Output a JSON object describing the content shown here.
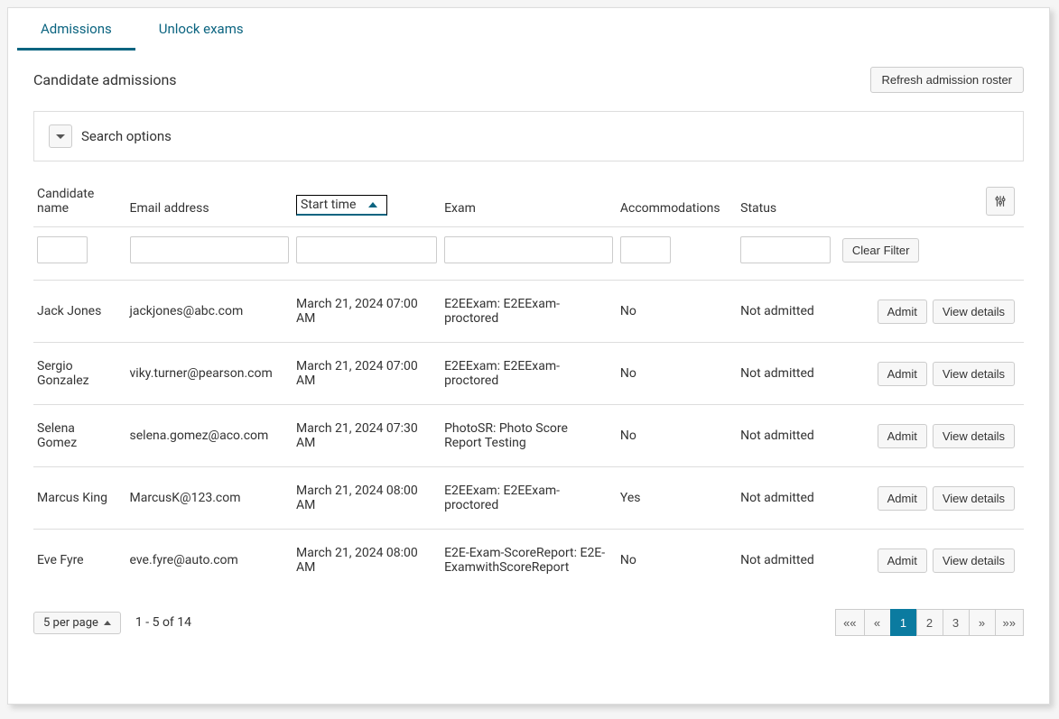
{
  "tabs": {
    "admissions": "Admissions",
    "unlock_exams": "Unlock exams"
  },
  "section": {
    "title": "Candidate admissions",
    "refresh_label": "Refresh admission roster",
    "search_options_label": "Search options"
  },
  "columns": {
    "candidate_name": "Candidate name",
    "email": "Email address",
    "start_time": "Start time",
    "exam": "Exam",
    "accommodations": "Accommodations",
    "status": "Status"
  },
  "filter": {
    "clear_label": "Clear Filter"
  },
  "row_actions": {
    "admit": "Admit",
    "view": "View details"
  },
  "rows": [
    {
      "name": "Jack Jones",
      "email": "jackjones@abc.com",
      "start": "March 21, 2024 07:00 AM",
      "exam": "E2EExam: E2EExam-proctored",
      "accom": "No",
      "status": "Not admitted"
    },
    {
      "name": "Sergio Gonzalez",
      "email": "viky.turner@pearson.com",
      "start": "March 21, 2024 07:00 AM",
      "exam": "E2EExam: E2EExam-proctored",
      "accom": "No",
      "status": "Not admitted"
    },
    {
      "name": "Selena Gomez",
      "email": "selena.gomez@aco.com",
      "start": "March 21, 2024 07:30 AM",
      "exam": "PhotoSR: Photo Score Report Testing",
      "accom": "No",
      "status": "Not admitted"
    },
    {
      "name": "Marcus King",
      "email": "MarcusK@123.com",
      "start": "March 21, 2024 08:00 AM",
      "exam": "E2EExam: E2EExam-proctored",
      "accom": "Yes",
      "status": "Not admitted"
    },
    {
      "name": "Eve Fyre",
      "email": "eve.fyre@auto.com",
      "start": "March 21, 2024 08:00 AM",
      "exam": "E2E-Exam-ScoreReport: E2E-ExamwithScoreReport",
      "accom": "No",
      "status": "Not admitted"
    }
  ],
  "pagination": {
    "per_page_label": "5 per page",
    "range_text": "1 - 5 of 14",
    "pages": [
      "1",
      "2",
      "3"
    ],
    "current": "1",
    "first": "««",
    "prev": "«",
    "next": "»",
    "last": "»»"
  }
}
